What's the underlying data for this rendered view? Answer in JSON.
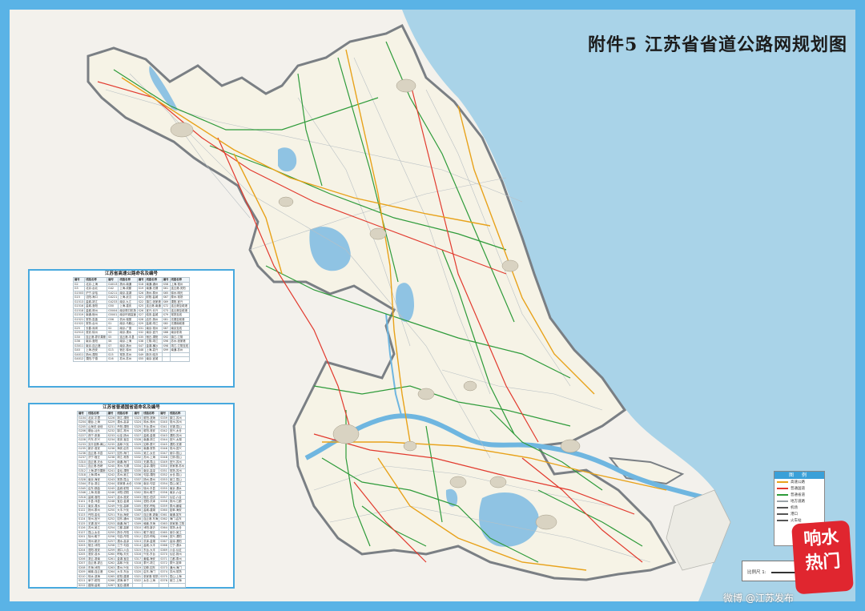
{
  "title": "附件5 江苏省省道公路网规划图",
  "expressway_table": {
    "title": "江苏省高速公路命名及编号",
    "header": [
      "编号",
      "线路名称",
      "编号",
      "线路名称",
      "编号",
      "线路名称",
      "编号",
      "线路名称"
    ],
    "rows": [
      [
        "G2",
        "北京-上海",
        "G4013",
        "扬州-南通",
        "S18",
        "南通-通州",
        "S58",
        "上海-常州"
      ],
      [
        "G3",
        "北京-台北",
        "G42",
        "上海-成都",
        "S19",
        "南通-无锡",
        "S61",
        "连云港-安阳"
      ],
      [
        "G1503",
        "沪宁-京哈",
        "G4211",
        "南京-芜湖",
        "S26",
        "扬州-泰州",
        "S65",
        "徐州-明光"
      ],
      [
        "G15",
        "沈阳-海口",
        "G4221",
        "上海-武汉",
        "S21",
        "射阳-盐城",
        "S67",
        "泰州-常熟"
      ],
      [
        "G1513",
        "盐城-靖江",
        "G4233",
        "南京-九江",
        "S22",
        "镇江-张家港",
        "S69",
        "溧阳-宜兴"
      ],
      [
        "G1516",
        "盐城-洛阳",
        "G50",
        "上海-重庆",
        "S25",
        "连云港-南通",
        "S72",
        "连云港至疏港"
      ],
      [
        "G1518",
        "盐城-林州",
        "G5004",
        "南京禄口机场",
        "S26",
        "宜兴-长兴",
        "S73",
        "连云港至疏港"
      ],
      [
        "G1519",
        "南通-宿州",
        "G5001",
        "南京环城高速",
        "S27",
        "临安-盐城",
        "S79",
        "常熟支线"
      ],
      [
        "G1521",
        "常熟-嘉善",
        "G56",
        "杭州-瑞丽",
        "S28",
        "启东-扬州",
        "S81",
        "无锡至疏港"
      ],
      [
        "G1522",
        "常熟-台州",
        "S1",
        "南京-马鞍山",
        "S29",
        "盐城-靖江",
        "S82",
        "无锡南疏港"
      ],
      [
        "G25",
        "长春-深圳",
        "S2",
        "南京-广德",
        "S31",
        "南京-常州",
        "S87",
        "南京支线"
      ],
      [
        "G2513",
        "淮安-徐州",
        "S3",
        "南京-溧水",
        "S32",
        "南京-宜兴",
        "S88",
        "南京机场"
      ],
      [
        "G30",
        "连云港-霍尔果斯",
        "S5",
        "连云港-丰县",
        "S35",
        "宿迁-溧阳",
        "S92",
        "镇江-江阴"
      ],
      [
        "G36",
        "南京-洛阳",
        "S6",
        "南京-上海",
        "S38",
        "江阴-靖江",
        "S96",
        "苏州-张家港"
      ],
      [
        "G3011",
        "南京-连云港",
        "S7",
        "南京-扬州",
        "S47",
        "金湖-横沙",
        "S98",
        "靖江-江阴支线"
      ],
      [
        "G40",
        "上海-西安",
        "S13",
        "宿迁-徐州",
        "S48",
        "上海-嘉兴",
        "S99",
        "南通-苏州"
      ],
      [
        "G4011",
        "扬州-溧阳",
        "S15",
        "常熟-苏州",
        "S49",
        "新沂-临沂",
        "",
        ""
      ],
      [
        "G4012",
        "溧阳-宁德",
        "S16",
        "苏州-苏州",
        "S55",
        "南京-宜城",
        "",
        ""
      ]
    ]
  },
  "provincial_table": {
    "title": "江苏省普通国省道命名及编号",
    "header": [
      "编号",
      "线路名称",
      "编号",
      "线路名称",
      "编号",
      "线路名称",
      "编号",
      "线路名称"
    ],
    "rows": [
      [
        "G104",
        "北京-平潭",
        "S226",
        "靖江-溧阳",
        "S323",
        "射阳-滨海",
        "S339",
        "镇江-苏州"
      ],
      [
        "G204",
        "烟台-上海",
        "S229",
        "溧水-高淳",
        "S324",
        "响水-邳州",
        "S340",
        "常州-苏州"
      ],
      [
        "G205",
        "山海关-深圳",
        "S231",
        "丹阳-溧阳",
        "S325",
        "东台-泰州",
        "S341",
        "无锡-昆山"
      ],
      [
        "G206",
        "烟台-汕头",
        "S232",
        "镇江-常州",
        "S326",
        "射阳-淮安",
        "S342",
        "宜兴-太仓"
      ],
      [
        "G227",
        "西宁-张掖",
        "S233",
        "仪征-扬州",
        "S327",
        "盐城-金湖",
        "S343",
        "溧阳-苏州"
      ],
      [
        "G228",
        "丹东-东兴",
        "S234",
        "淮安-宝应",
        "S328",
        "南通-靖江",
        "S344",
        "宜兴-太湖"
      ],
      [
        "G233",
        "克什克腾-黄山",
        "S235",
        "高邮-兴化",
        "S329",
        "如皋-泰兴",
        "S345",
        "溧阳-无锡"
      ],
      [
        "G235",
        "新沂-淮安",
        "S236",
        "海安-启东",
        "S330",
        "南通-常熟",
        "S346",
        "常州-宜兴"
      ],
      [
        "G236",
        "连云港-丰县",
        "S237",
        "如东-海门",
        "S331",
        "吴江-太仓",
        "S347",
        "吴中-昆山"
      ],
      [
        "G237",
        "济宁-宿迁",
        "S238",
        "靖江-常熟",
        "S332",
        "苏州-上海",
        "S348",
        "江阴-昆山"
      ],
      [
        "G310",
        "连云港-天水",
        "S239",
        "南通-海门",
        "S333",
        "无锡-昆山",
        "S349",
        "宜兴-苏州"
      ],
      [
        "G311",
        "连云港-西峡",
        "S240",
        "常州-无锡",
        "S334",
        "高淳-溧阳",
        "S350",
        "张家港-苏州"
      ],
      [
        "G312",
        "上海-霍尔果斯",
        "S241",
        "金坛-溧阳",
        "S335",
        "南京-高淳",
        "S351",
        "常熟-苏州"
      ],
      [
        "G318",
        "上海-樟木",
        "S242",
        "苏州-吴江",
        "S336",
        "句容-溧阳",
        "S352",
        "太仓-昆山"
      ],
      [
        "G328",
        "南京-海安",
        "S243",
        "常熟-昆山",
        "S337",
        "扬州-泰州",
        "S353",
        "吴江-昆山"
      ],
      [
        "G344",
        "东台-灌云",
        "S244",
        "张家港-太仓",
        "S338",
        "南京-句容",
        "S354",
        "昆山-吴江"
      ],
      [
        "G345",
        "启东-那曲",
        "S245",
        "盐城-射阳",
        "S301",
        "徐州-丰县",
        "S355",
        "南京-溧水"
      ],
      [
        "G346",
        "上海-安康",
        "S246",
        "沭阳-泗阳",
        "S302",
        "邳州-睢宁",
        "S356",
        "南京-六合"
      ],
      [
        "G516",
        "盐城-洛阳",
        "S247",
        "涟水-淮安",
        "S303",
        "宿迁-泗洪",
        "S357",
        "仪征-六合"
      ],
      [
        "S101",
        "丰县-沛县",
        "S248",
        "宝应-金湖",
        "S304",
        "泗阳-洪泽",
        "S358",
        "扬州-江都"
      ],
      [
        "S121",
        "南京-溧水",
        "S249",
        "兴化-高邮",
        "S305",
        "淮安-盱眙",
        "S359",
        "泰州-姜堰"
      ],
      [
        "S122",
        "扬州-泰州",
        "S250",
        "大丰-兴化",
        "S306",
        "盐城-建湖",
        "S360",
        "如皋-海安"
      ],
      [
        "S123",
        "丹阳-金坛",
        "S251",
        "东台-海安",
        "S307",
        "连云港-灌南",
        "S361",
        "南通-如东"
      ],
      [
        "S124",
        "常州-宜兴",
        "S252",
        "如东-通州",
        "S308",
        "连云港-东海",
        "S362",
        "海门-启东"
      ],
      [
        "S125",
        "无锡-宜兴",
        "S253",
        "南通-海门",
        "S309",
        "赣榆-东海",
        "S363",
        "张家港-江阴"
      ],
      [
        "S126",
        "苏州-吴江",
        "S254",
        "江都-高邮",
        "S310",
        "沭阳-新沂",
        "S364",
        "常熟-太仓"
      ],
      [
        "S127",
        "昆山-太仓",
        "S255",
        "扬中-丹阳",
        "S311",
        "睢宁-宿迁",
        "S365",
        "吴中-吴江"
      ],
      [
        "S201",
        "徐州-睢宁",
        "S256",
        "句容-丹阳",
        "S312",
        "泗洪-盱眙",
        "S366",
        "宜兴-溧阳"
      ],
      [
        "S202",
        "邳州-新沂",
        "S257",
        "溧水-高淳",
        "S313",
        "洪泽-金湖",
        "S367",
        "高淳-溧阳"
      ],
      [
        "S203",
        "宿迁-沭阳",
        "S258",
        "江宁-句容",
        "S314",
        "盐城-大丰",
        "S368",
        "江宁-溧水"
      ],
      [
        "S204",
        "泗阳-淮安",
        "S259",
        "浦口-六合",
        "S315",
        "东台-大丰",
        "S369",
        "六合-仪征"
      ],
      [
        "S205",
        "淮安-涟水",
        "S260",
        "盱眙-天长",
        "S316",
        "兴化-东台",
        "S370",
        "仪征-扬州"
      ],
      [
        "S206",
        "灌云-灌南",
        "S261",
        "金湖-宝应",
        "S317",
        "姜堰-海安",
        "S371",
        "江都-泰州"
      ],
      [
        "S207",
        "连云港-灌云",
        "S262",
        "高邮-兴化",
        "S318",
        "泰兴-靖江",
        "S372",
        "泰兴-如皋"
      ],
      [
        "S208",
        "东海-沭阳",
        "S263",
        "泰州-兴化",
        "S319",
        "如皋-如东",
        "S373",
        "通州-海门"
      ],
      [
        "S209",
        "赣榆-连云港",
        "S264",
        "大丰-东台",
        "S320",
        "启东-海门",
        "S374",
        "苏州-常熟"
      ],
      [
        "S210",
        "响水-滨海",
        "S265",
        "射阳-建湖",
        "S321",
        "张家港-常熟",
        "S375",
        "昆山-上海"
      ],
      [
        "S211",
        "阜宁-射阳",
        "S266",
        "滨海-阜宁",
        "S322",
        "太仓-上海",
        "S376",
        "吴江-上海"
      ],
      [
        "S212",
        "建湖-盐城",
        "S267",
        "宝应-建湖",
        "",
        "",
        " ",
        ""
      ]
    ]
  },
  "legend": {
    "title": "图 例",
    "items": [
      {
        "label": "高速公路",
        "color": "#e8a21a"
      },
      {
        "label": "普通国道",
        "color": "#e23a2e"
      },
      {
        "label": "普通省道",
        "color": "#2e9b3a"
      },
      {
        "label": "地方道路",
        "color": "#9aa3a8"
      },
      {
        "label": "机场",
        "color": "#555555"
      },
      {
        "label": "港口",
        "color": "#555555"
      },
      {
        "label": "火车站",
        "color": "#555555"
      }
    ]
  },
  "scale": {
    "label": "比例尺 1:"
  },
  "stamp": {
    "line1": "响水",
    "line2": "热门"
  },
  "watermark": "微博 @江苏发布"
}
